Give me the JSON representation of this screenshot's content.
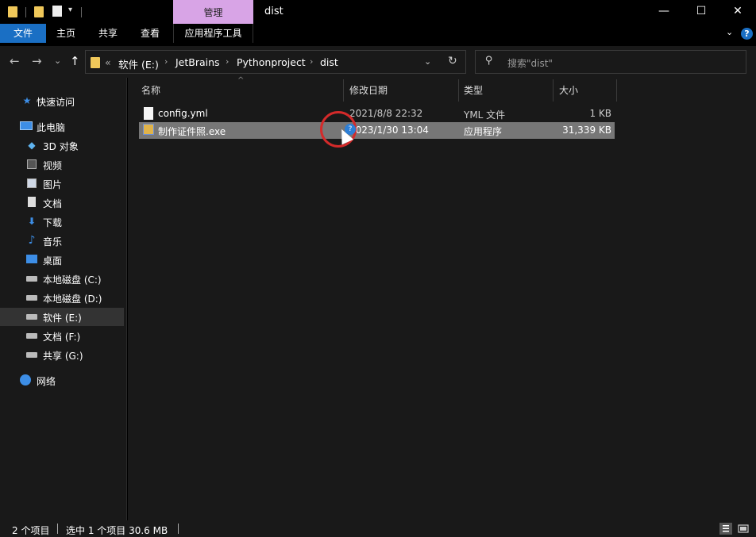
{
  "window": {
    "title": "dist",
    "manage_tab": "管理",
    "minimize": "—",
    "maximize": "☐",
    "close": "✕"
  },
  "ribbon": {
    "tabs": [
      "文件",
      "主页",
      "共享",
      "查看",
      "应用程序工具"
    ],
    "expand": "⌄",
    "help": "?"
  },
  "nav": {
    "back": "←",
    "forward": "→",
    "recent": "⌄",
    "up": "↑",
    "address": {
      "overflow": "«",
      "crumbs": [
        "软件 (E:)",
        "JetBrains",
        "Pythonproject",
        "dist"
      ],
      "sep": "›",
      "dropdown": "⌄",
      "refresh": "↻"
    },
    "search": {
      "placeholder": "搜索\"dist\""
    }
  },
  "sidebar": {
    "items": [
      {
        "label": "快速访问",
        "icon": "star-icon"
      },
      {
        "label": "此电脑",
        "icon": "computer-icon"
      },
      {
        "label": "3D 对象",
        "icon": "cube-icon"
      },
      {
        "label": "视频",
        "icon": "video-icon"
      },
      {
        "label": "图片",
        "icon": "picture-icon"
      },
      {
        "label": "文档",
        "icon": "document-icon"
      },
      {
        "label": "下载",
        "icon": "download-icon"
      },
      {
        "label": "音乐",
        "icon": "music-icon"
      },
      {
        "label": "桌面",
        "icon": "desktop-icon"
      },
      {
        "label": "本地磁盘 (C:)",
        "icon": "drive-icon"
      },
      {
        "label": "本地磁盘 (D:)",
        "icon": "drive-icon"
      },
      {
        "label": "软件 (E:)",
        "icon": "drive-icon",
        "selected": true
      },
      {
        "label": "文档 (F:)",
        "icon": "drive-icon"
      },
      {
        "label": "共享 (G:)",
        "icon": "drive-icon"
      },
      {
        "label": "网络",
        "icon": "network-icon"
      }
    ]
  },
  "columns": [
    "名称",
    "修改日期",
    "类型",
    "大小"
  ],
  "files": [
    {
      "name": "config.yml",
      "modified": "2021/8/8 22:32",
      "type": "YML 文件",
      "size": "1 KB"
    },
    {
      "name": "制作证件照.exe",
      "modified": "2023/1/30 13:04",
      "type": "应用程序",
      "size": "31,339 KB",
      "selected": true
    }
  ],
  "status": {
    "count": "2 个项目",
    "selection": "选中 1 个项目  30.6 MB"
  },
  "colors": {
    "accent": "#1a6fc4",
    "manage_tab": "#d8a4e6",
    "cursor_ring": "#d42a2a"
  }
}
